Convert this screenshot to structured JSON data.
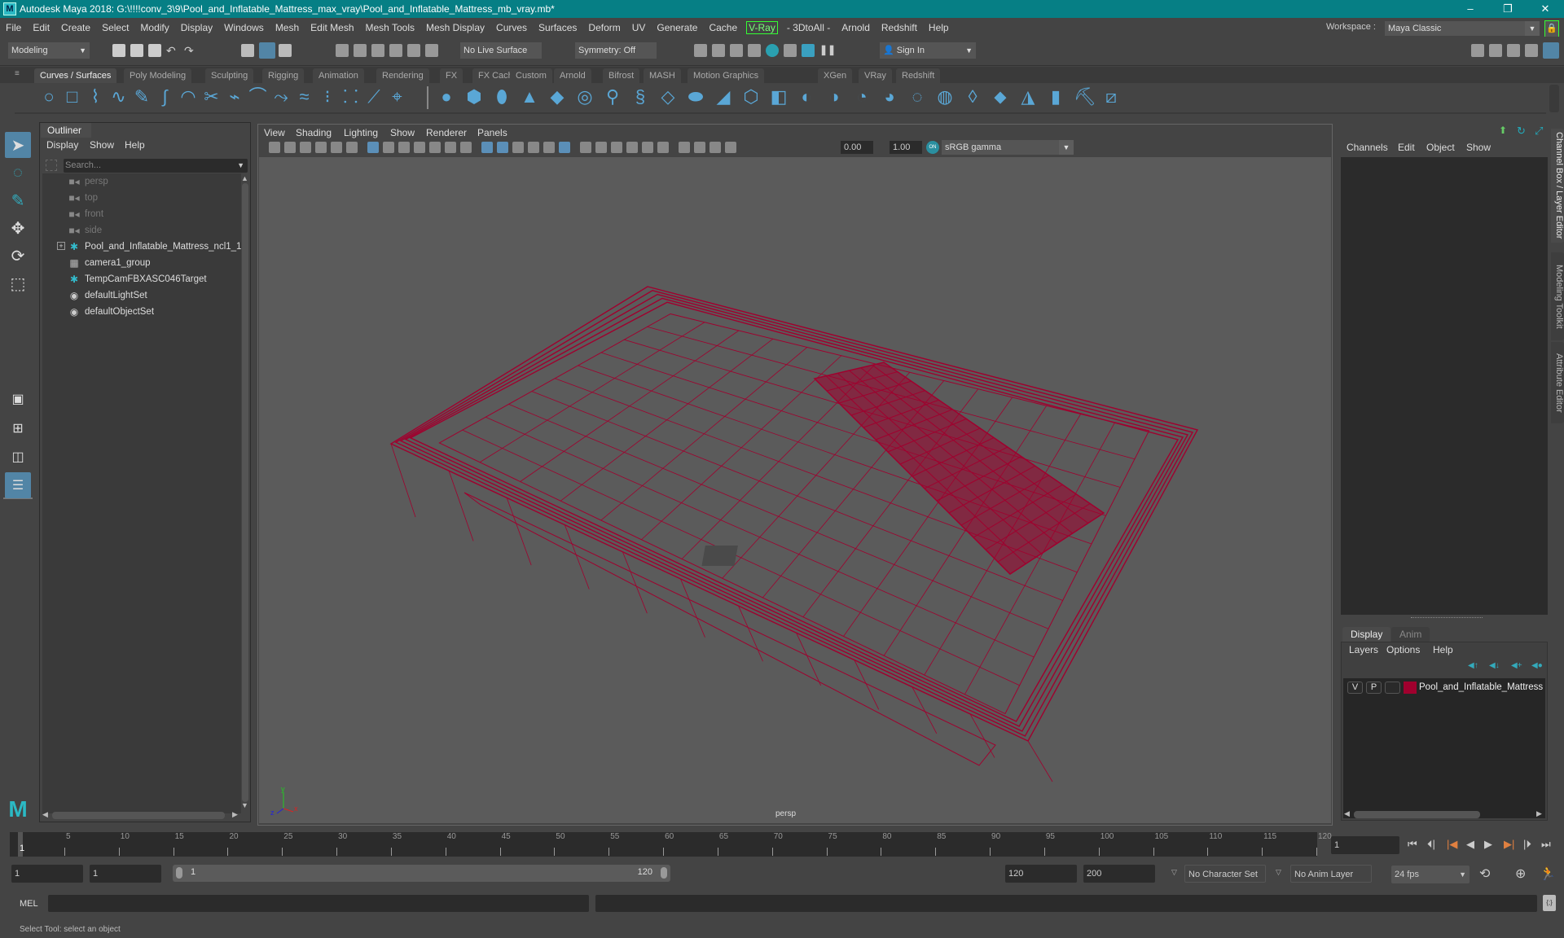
{
  "window": {
    "title": "Autodesk Maya 2018: G:\\!!!!conv_3\\9\\Pool_and_Inflatable_Mattress_max_vray\\Pool_and_Inflatable_Mattress_mb_vray.mb*",
    "controls": {
      "minimize": "–",
      "maximize": "❐",
      "close": "✕"
    }
  },
  "menubar": [
    "File",
    "Edit",
    "Create",
    "Select",
    "Modify",
    "Display",
    "Windows",
    "Mesh",
    "Edit Mesh",
    "Mesh Tools",
    "Mesh Display",
    "Curves",
    "Surfaces",
    "Deform",
    "UV",
    "Generate",
    "Cache",
    "V-Ray",
    "- 3DtoAll -",
    "Arnold",
    "Redshift",
    "Help"
  ],
  "workspace": {
    "label": "Workspace :",
    "value": "Maya Classic"
  },
  "statusline": {
    "mode": "Modeling",
    "live_surface": "No Live Surface",
    "symmetry": "Symmetry: Off",
    "sign_in": "Sign In"
  },
  "shelf": {
    "tabs": [
      "Curves / Surfaces",
      "Poly Modeling",
      "Sculpting",
      "Rigging",
      "Animation",
      "Rendering",
      "FX",
      "FX Caching",
      "Custom",
      "Arnold",
      "Bifrost",
      "MASH",
      "Motion Graphics",
      "XGen",
      "VRay",
      "Redshift"
    ],
    "active_tab": "Curves / Surfaces"
  },
  "outliner": {
    "title": "Outliner",
    "menu": [
      "Display",
      "Show",
      "Help"
    ],
    "search_placeholder": "Search...",
    "items": [
      {
        "label": "persp",
        "icon": "camera-icon",
        "dim": true
      },
      {
        "label": "top",
        "icon": "camera-icon",
        "dim": true
      },
      {
        "label": "front",
        "icon": "camera-icon",
        "dim": true
      },
      {
        "label": "side",
        "icon": "camera-icon",
        "dim": true
      },
      {
        "label": "Pool_and_Inflatable_Mattress_ncl1_1",
        "icon": "locator-icon",
        "expandable": true
      },
      {
        "label": "camera1_group",
        "icon": "group-icon"
      },
      {
        "label": "TempCamFBXASC046Target",
        "icon": "locator-icon"
      },
      {
        "label": "defaultLightSet",
        "icon": "set-icon"
      },
      {
        "label": "defaultObjectSet",
        "icon": "set-icon"
      }
    ]
  },
  "viewport": {
    "menu": [
      "View",
      "Shading",
      "Lighting",
      "Show",
      "Renderer",
      "Panels"
    ],
    "exposure": "0.00",
    "gamma": "1.00",
    "color_space": "sRGB gamma",
    "camera_label": "persp",
    "wire_color": "#a0002e",
    "axis": {
      "x": "x",
      "y": "y",
      "z": "z"
    }
  },
  "channel_box": {
    "menu": [
      "Channels",
      "Edit",
      "Object",
      "Show"
    ],
    "side_tabs": [
      "Channel Box / Layer Editor",
      "Modeling Toolkit",
      "Attribute Editor"
    ]
  },
  "layer_editor": {
    "tabs": [
      "Display",
      "Anim"
    ],
    "menu": [
      "Layers",
      "Options",
      "Help"
    ],
    "layers": [
      {
        "v": "V",
        "p": "P",
        "name": "Pool_and_Inflatable_Mattress",
        "color": "#a0002e"
      }
    ]
  },
  "timeline": {
    "ticks": [
      5,
      10,
      15,
      20,
      25,
      30,
      35,
      40,
      45,
      50,
      55,
      60,
      65,
      70,
      75,
      80,
      85,
      90,
      95,
      100,
      105,
      110,
      115,
      120
    ],
    "current_frame_marker": "1",
    "current_frame": "1"
  },
  "range": {
    "start": "1",
    "playback_start": "1",
    "slider_start": "1",
    "slider_end": "120",
    "playback_end": "120",
    "end": "200",
    "character_set": "No Character Set",
    "anim_layer": "No Anim Layer",
    "fps": "24 fps"
  },
  "command": {
    "label": "MEL"
  },
  "help_line": "Select Tool: select an object"
}
